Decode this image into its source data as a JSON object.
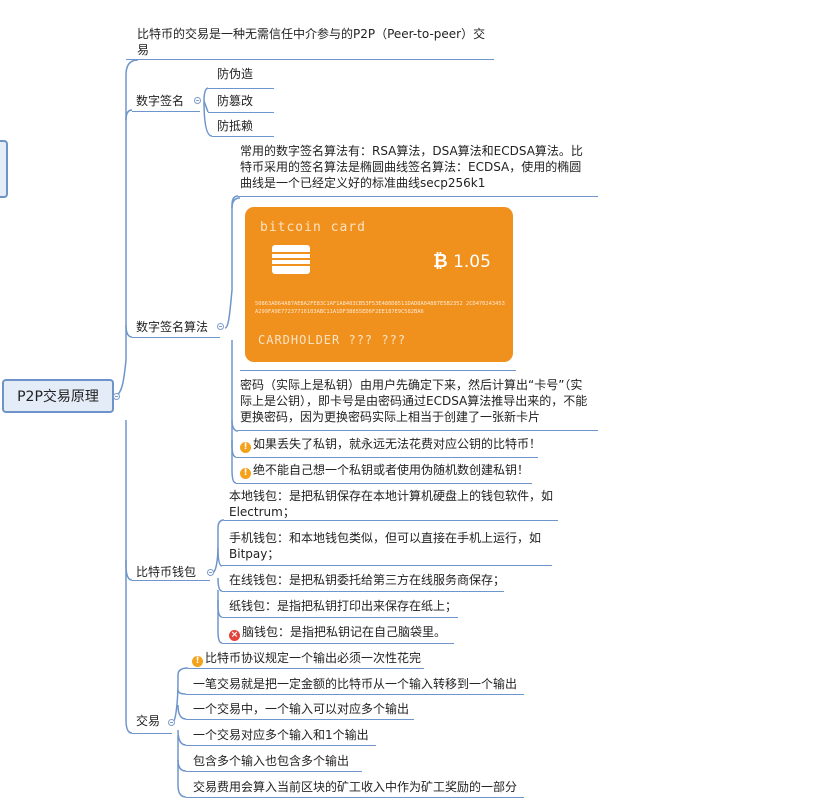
{
  "root": {
    "label": "P2P交易原理"
  },
  "intro": "比特币的交易是一种无需信任中介参与的P2P（Peer-to-peer）交易",
  "branches": {
    "signature": {
      "label": "数字签名",
      "items": [
        "防伪造",
        "防篡改",
        "防抵赖"
      ]
    },
    "algorithm": {
      "label": "数字签名算法",
      "desc": "常用的数字签名算法有：RSA算法，DSA算法和ECDSA算法。比特币采用的签名算法是椭圆曲线签名算法：ECDSA，使用的椭圆曲线是一个已经定义好的标准曲线secp256k1",
      "card": {
        "brand": "bitcoin card",
        "amount": "1.05",
        "currency_symbol": "₿",
        "hex": "50863AD64A87AE8A2FE83C1AF1A8403CB53F53E486D8511DAD8A04887E5B2352 2CD470243453A299FA9E77237716103ABC11A1DF38855ED6F2EE187E9C582BA6",
        "holder": "CARDHOLDER ??? ???"
      },
      "explain": "密码（实际上是私钥）由用户先确定下来，然后计算出“卡号”（实际上是公钥），即卡号是由密码通过ECDSA算法推导出来的，不能更换密码，因为更换密码实际上相当于创建了一张新卡片",
      "warnings": [
        "如果丢失了私钥，就永远无法花费对应公钥的比特币！",
        "绝不能自己想一个私钥或者使用伪随机数创建私钥！"
      ]
    },
    "wallet": {
      "label": "比特币钱包",
      "items": [
        "本地钱包：是把私钥保存在本地计算机硬盘上的钱包软件，如Electrum；",
        "手机钱包：和本地钱包类似，但可以直接在手机上运行，如Bitpay；",
        "在线钱包：是把私钥委托给第三方在线服务商保存；",
        "纸钱包：是指把私钥打印出来保存在纸上；",
        "脑钱包：是指把私钥记在自己脑袋里。"
      ]
    },
    "transaction": {
      "label": "交易",
      "items": [
        "比特币协议规定一个输出必须一次性花完",
        "一笔交易就是把一定金额的比特币从一个输入转移到一个输出",
        "一个交易中，一个输入可以对应多个输出",
        "一个交易对应多个输入和1个输出",
        "包含多个输入也包含多个输出",
        "交易费用会算入当前区块的矿工收入中作为矿工奖励的一部分"
      ]
    }
  },
  "colors": {
    "line": "#6e95cc",
    "card": "#f0901d",
    "warning": "#f4a11b",
    "error": "#e0443c"
  }
}
